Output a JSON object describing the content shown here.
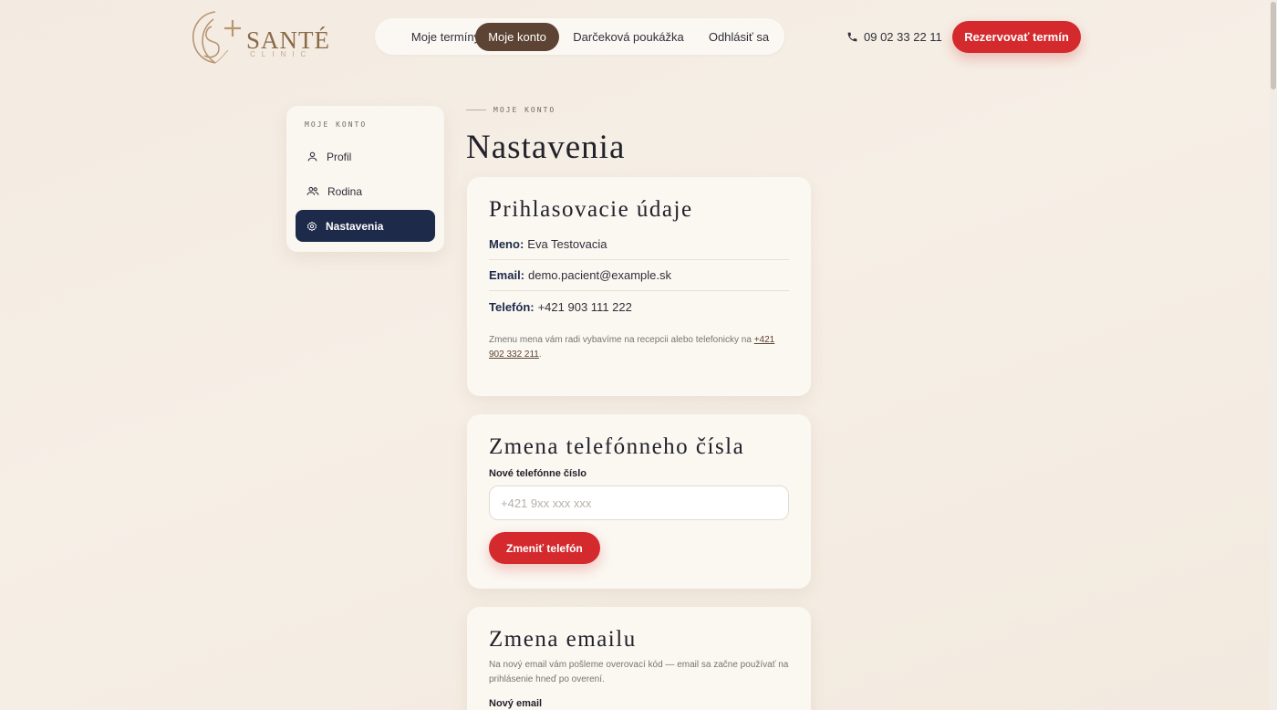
{
  "brand": {
    "name": "SANTÉ",
    "sub": "CLINIC"
  },
  "nav": {
    "items": [
      {
        "label": "Moje termíny",
        "active": false
      },
      {
        "label": "Moje konto",
        "active": true
      },
      {
        "label": "Darčeková poukážka",
        "active": false
      },
      {
        "label": "Odhlásiť sa",
        "active": false
      }
    ]
  },
  "header": {
    "phone": "09 02 33 22 11",
    "book_label": "Rezervovať termín"
  },
  "sidebar": {
    "heading": "MOJE KONTO",
    "items": [
      {
        "label": "Profil",
        "icon": "user-icon",
        "active": false
      },
      {
        "label": "Rodina",
        "icon": "users-icon",
        "active": false
      },
      {
        "label": "Nastavenia",
        "icon": "gear-icon",
        "active": true
      }
    ]
  },
  "page": {
    "eyebrow": "MOJE KONTO",
    "title": "Nastavenia"
  },
  "login_card": {
    "title": "Prihlasovacie údaje",
    "rows": [
      {
        "label": "Meno:",
        "value": "Eva Testovacia"
      },
      {
        "label": "Email:",
        "value": "demo.pacient@example.sk"
      },
      {
        "label": "Telefón:",
        "value": "+421 903 111 222"
      }
    ],
    "note": "Zmenu mena vám radi vybavíme na recepcii alebo telefonicky na",
    "note_link": "+421 902 332 211",
    "note_end": "."
  },
  "phone_card": {
    "title": "Zmena telefónneho čísla",
    "field_label": "Nové telefónne číslo",
    "placeholder": "+421 9xx xxx xxx",
    "button_label": "Zmeniť telefón"
  },
  "email_card": {
    "title": "Zmena emailu",
    "note": "Na nový email vám pošleme overovací kód — email sa začne používať na prihlásenie hneď po overení.",
    "field_label": "Nový email"
  },
  "colors": {
    "accent_red": "#d42a2d",
    "nav_active": "#5d4334",
    "sidebar_active": "#1e2a4a",
    "brand_gold": "#8a6a48"
  }
}
